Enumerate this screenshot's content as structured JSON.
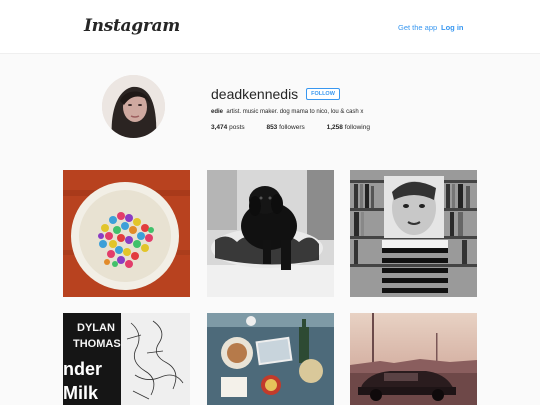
{
  "header": {
    "logo": "Instagram",
    "get_app": "Get the app",
    "login": "Log in"
  },
  "profile": {
    "username": "deadkennedis",
    "follow_label": "FOLLOW",
    "name": "edie",
    "bio": "artist. music maker. dog mama to nico, lou & cash x",
    "posts_count": "3,474",
    "posts_label": "posts",
    "followers_count": "853",
    "followers_label": "followers",
    "following_count": "1,258",
    "following_label": "following"
  },
  "posts": [
    {
      "subject": "plate of colorful candy"
    },
    {
      "subject": "black puppy on patterned cushion"
    },
    {
      "subject": "person with face photo in front of bookshelves"
    },
    {
      "subject": "dylan thomas book and sketch",
      "cover_line1": "DYLAN",
      "cover_line2": "THOMAS",
      "cover_line3": "nder",
      "cover_line4": "Milk"
    },
    {
      "subject": "table with drinks and notebook"
    },
    {
      "subject": "car on road at sunset"
    }
  ]
}
